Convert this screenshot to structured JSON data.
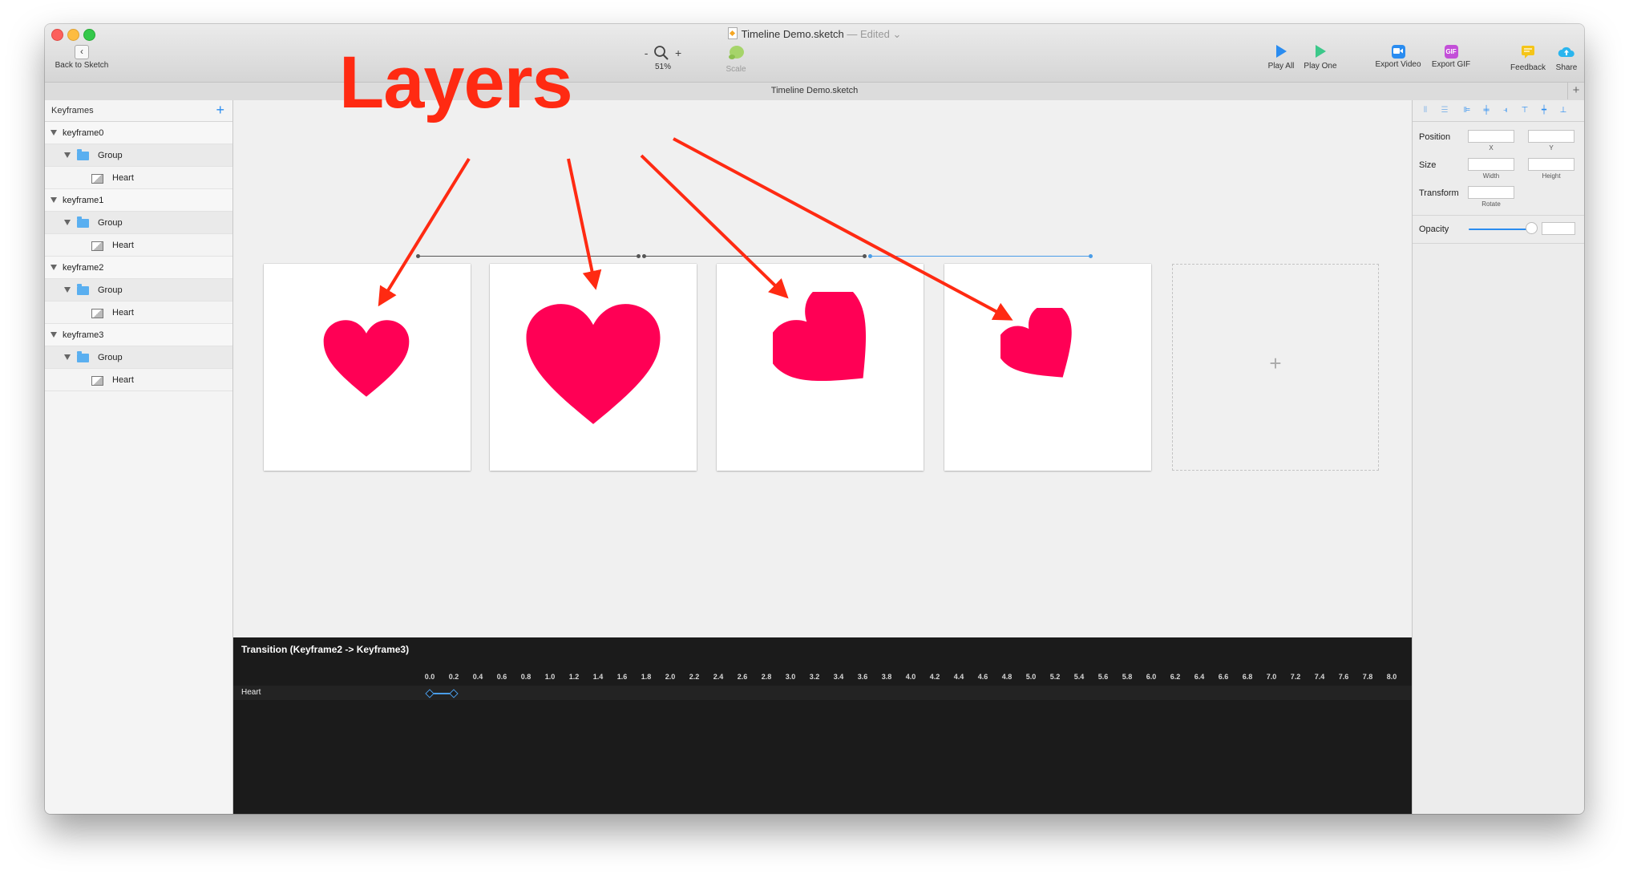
{
  "window": {
    "title": "Timeline Demo.sketch",
    "edited": " — Edited",
    "edited_chevron": "⌄"
  },
  "toolbar": {
    "back_label": "Back to Sketch",
    "back_glyph": "‹",
    "zoom_minus": "-",
    "zoom_plus": "+",
    "zoom_level": "51%",
    "scale_label": "Scale",
    "play_all_label": "Play All",
    "play_one_label": "Play One",
    "export_video_label": "Export Video",
    "export_gif_label": "Export GIF",
    "gif_badge": "GIF",
    "feedback_label": "Feedback",
    "share_label": "Share",
    "colors": {
      "play": "#2a8cf0",
      "play_one": "#3cc88a",
      "export_video": "#2a8cf0",
      "export_gif": "#c34fd8",
      "feedback": "#f5c518",
      "share": "#2ab5ee"
    }
  },
  "docbar": {
    "title": "Timeline Demo.sketch",
    "add_glyph": "+"
  },
  "sidebar": {
    "header": "Keyframes",
    "add_glyph": "+",
    "keyframes": [
      {
        "name": "keyframe0",
        "group": "Group",
        "layer": "Heart"
      },
      {
        "name": "keyframe1",
        "group": "Group",
        "layer": "Heart"
      },
      {
        "name": "keyframe2",
        "group": "Group",
        "layer": "Heart"
      },
      {
        "name": "keyframe3",
        "group": "Group",
        "layer": "Heart"
      }
    ]
  },
  "canvas": {
    "add_glyph": "+",
    "heart_color": "#ff0055",
    "transition_colors": [
      "#555555",
      "#555555",
      "#4a9de8"
    ]
  },
  "inspector": {
    "position_label": "Position",
    "x_label": "X",
    "y_label": "Y",
    "size_label": "Size",
    "width_label": "Width",
    "height_label": "Height",
    "transform_label": "Transform",
    "rotate_label": "Rotate",
    "opacity_label": "Opacity",
    "opacity_value": "",
    "opacity_level": 0.88
  },
  "timeline": {
    "title": "Transition (Keyframe2 -> Keyframe3)",
    "layer": "Heart",
    "ticks": [
      "0.0",
      "0.2",
      "0.4",
      "0.6",
      "0.8",
      "1.0",
      "1.2",
      "1.4",
      "1.6",
      "1.8",
      "2.0",
      "2.2",
      "2.4",
      "2.6",
      "2.8",
      "3.0",
      "3.2",
      "3.4",
      "3.6",
      "3.8",
      "4.0",
      "4.2",
      "4.4",
      "4.6",
      "4.8",
      "5.0",
      "5.2",
      "5.4",
      "5.6",
      "5.8",
      "6.0",
      "6.2",
      "6.4",
      "6.6",
      "6.8",
      "7.0",
      "7.2",
      "7.4",
      "7.6",
      "7.8",
      "8.0",
      "8"
    ],
    "keyframe_times": [
      0.0,
      0.2
    ],
    "keyframe_color": "#4a9de8"
  },
  "annotation": {
    "text": "Layers",
    "color": "#ff2a12"
  }
}
